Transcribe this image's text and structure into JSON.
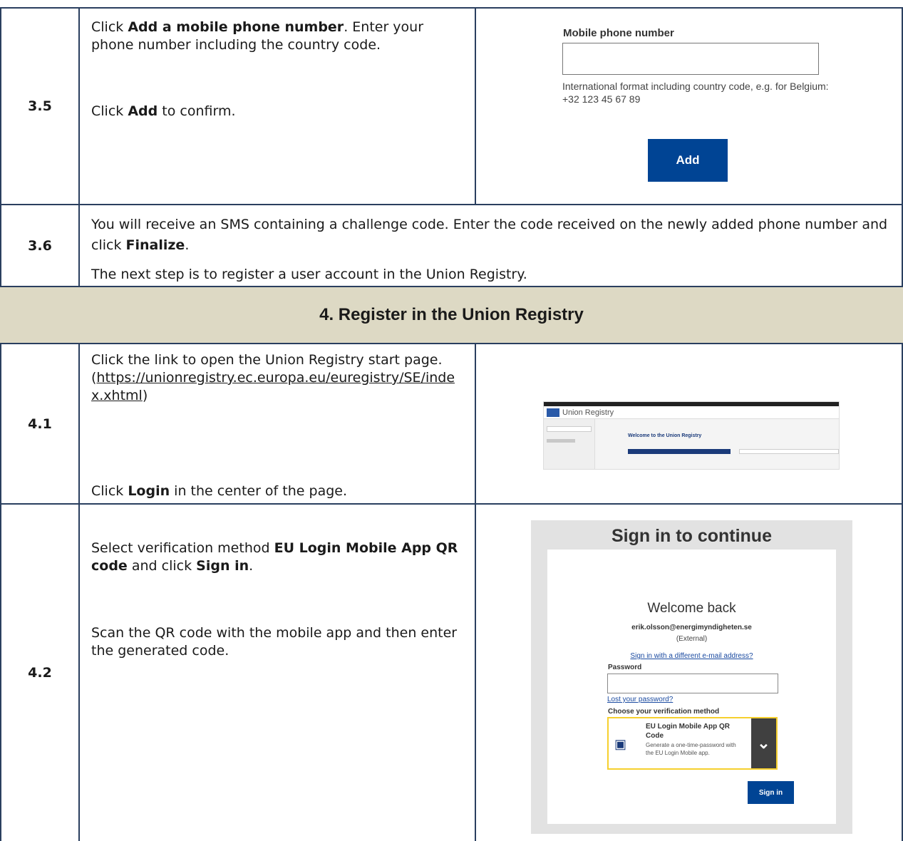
{
  "rows": {
    "r35": {
      "number": "3.5",
      "line1_pre": "Click ",
      "line1_bold": "Add a mobile phone number",
      "line1_post": ". Enter your phone number including the country code.",
      "line2_pre": "Click ",
      "line2_bold": "Add",
      "line2_post": " to confirm."
    },
    "r36": {
      "number": "3.6",
      "line1_pre": "You will receive an SMS containing a challenge code. Enter the code received on the newly added phone number and click ",
      "line1_bold": "Finalize",
      "line1_post": ".",
      "line2": "The next step is to register a user account in the Union Registry."
    },
    "r41": {
      "number": "4.1",
      "line1": "Click the link to open the Union Registry start page.",
      "link_open": "(",
      "link": "https://unionregistry.ec.europa.eu/euregistry/SE/index.xhtml",
      "link_close": ")",
      "line2_pre": "Click ",
      "line2_bold": "Login",
      "line2_post": " in the center of the page."
    },
    "r42": {
      "number": "4.2",
      "line1_pre": "Select verification method ",
      "line1_bold": "EU Login Mobile App QR code",
      "line1_mid": " and click ",
      "line1_bold2": "Sign in",
      "line1_post": ".",
      "line2": "Scan the QR code with the mobile app and then enter the generated code."
    }
  },
  "section_heading": "4.  Register in the Union Registry",
  "mobile_form": {
    "label": "Mobile phone number",
    "hint": "International format including country code, e.g. for Belgium: +32 123 45 67 89",
    "add_button": "Add"
  },
  "union_registry": {
    "title": "Union Registry",
    "welcome": "Welcome to the Union Registry"
  },
  "signin": {
    "title": "Sign in to continue",
    "welcome": "Welcome back",
    "email": "erik.olsson@energimyndigheten.se",
    "external": "(External)",
    "different_email": "Sign in with a different e-mail address?",
    "password_label": "Password",
    "lost_password": "Lost your password?",
    "method_label": "Choose your verification method",
    "method_title": "EU Login Mobile App QR Code",
    "method_desc": "Generate a one-time-password with the EU Login Mobile app.",
    "signin_button": "Sign in"
  },
  "colors": {
    "section_bg": "#ddd9c4",
    "button_blue": "#004494",
    "border": "#2a3f5f",
    "method_border": "#f6d02e"
  }
}
